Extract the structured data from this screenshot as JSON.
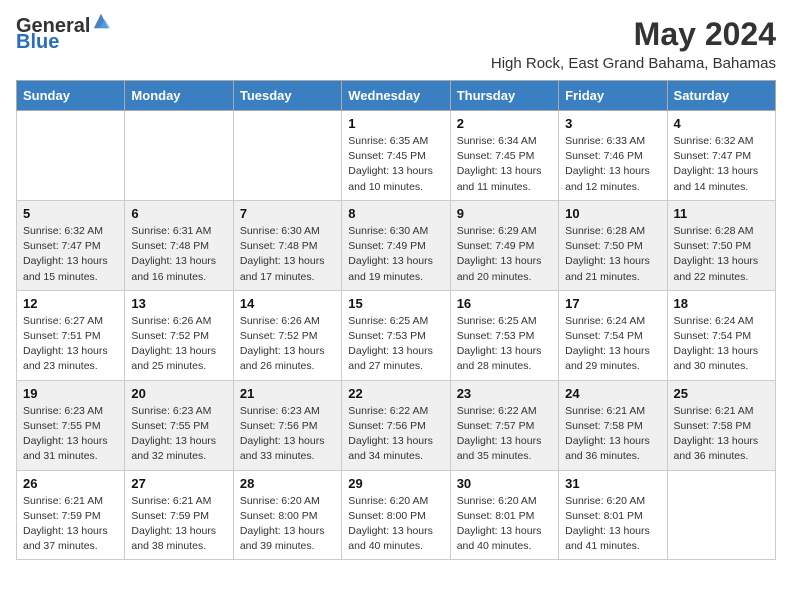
{
  "header": {
    "logo_general": "General",
    "logo_blue": "Blue",
    "title": "May 2024",
    "location": "High Rock, East Grand Bahama, Bahamas"
  },
  "weekdays": [
    "Sunday",
    "Monday",
    "Tuesday",
    "Wednesday",
    "Thursday",
    "Friday",
    "Saturday"
  ],
  "weeks": [
    [
      {
        "day": "",
        "info": ""
      },
      {
        "day": "",
        "info": ""
      },
      {
        "day": "",
        "info": ""
      },
      {
        "day": "1",
        "info": "Sunrise: 6:35 AM\nSunset: 7:45 PM\nDaylight: 13 hours\nand 10 minutes."
      },
      {
        "day": "2",
        "info": "Sunrise: 6:34 AM\nSunset: 7:45 PM\nDaylight: 13 hours\nand 11 minutes."
      },
      {
        "day": "3",
        "info": "Sunrise: 6:33 AM\nSunset: 7:46 PM\nDaylight: 13 hours\nand 12 minutes."
      },
      {
        "day": "4",
        "info": "Sunrise: 6:32 AM\nSunset: 7:47 PM\nDaylight: 13 hours\nand 14 minutes."
      }
    ],
    [
      {
        "day": "5",
        "info": "Sunrise: 6:32 AM\nSunset: 7:47 PM\nDaylight: 13 hours\nand 15 minutes."
      },
      {
        "day": "6",
        "info": "Sunrise: 6:31 AM\nSunset: 7:48 PM\nDaylight: 13 hours\nand 16 minutes."
      },
      {
        "day": "7",
        "info": "Sunrise: 6:30 AM\nSunset: 7:48 PM\nDaylight: 13 hours\nand 17 minutes."
      },
      {
        "day": "8",
        "info": "Sunrise: 6:30 AM\nSunset: 7:49 PM\nDaylight: 13 hours\nand 19 minutes."
      },
      {
        "day": "9",
        "info": "Sunrise: 6:29 AM\nSunset: 7:49 PM\nDaylight: 13 hours\nand 20 minutes."
      },
      {
        "day": "10",
        "info": "Sunrise: 6:28 AM\nSunset: 7:50 PM\nDaylight: 13 hours\nand 21 minutes."
      },
      {
        "day": "11",
        "info": "Sunrise: 6:28 AM\nSunset: 7:50 PM\nDaylight: 13 hours\nand 22 minutes."
      }
    ],
    [
      {
        "day": "12",
        "info": "Sunrise: 6:27 AM\nSunset: 7:51 PM\nDaylight: 13 hours\nand 23 minutes."
      },
      {
        "day": "13",
        "info": "Sunrise: 6:26 AM\nSunset: 7:52 PM\nDaylight: 13 hours\nand 25 minutes."
      },
      {
        "day": "14",
        "info": "Sunrise: 6:26 AM\nSunset: 7:52 PM\nDaylight: 13 hours\nand 26 minutes."
      },
      {
        "day": "15",
        "info": "Sunrise: 6:25 AM\nSunset: 7:53 PM\nDaylight: 13 hours\nand 27 minutes."
      },
      {
        "day": "16",
        "info": "Sunrise: 6:25 AM\nSunset: 7:53 PM\nDaylight: 13 hours\nand 28 minutes."
      },
      {
        "day": "17",
        "info": "Sunrise: 6:24 AM\nSunset: 7:54 PM\nDaylight: 13 hours\nand 29 minutes."
      },
      {
        "day": "18",
        "info": "Sunrise: 6:24 AM\nSunset: 7:54 PM\nDaylight: 13 hours\nand 30 minutes."
      }
    ],
    [
      {
        "day": "19",
        "info": "Sunrise: 6:23 AM\nSunset: 7:55 PM\nDaylight: 13 hours\nand 31 minutes."
      },
      {
        "day": "20",
        "info": "Sunrise: 6:23 AM\nSunset: 7:55 PM\nDaylight: 13 hours\nand 32 minutes."
      },
      {
        "day": "21",
        "info": "Sunrise: 6:23 AM\nSunset: 7:56 PM\nDaylight: 13 hours\nand 33 minutes."
      },
      {
        "day": "22",
        "info": "Sunrise: 6:22 AM\nSunset: 7:56 PM\nDaylight: 13 hours\nand 34 minutes."
      },
      {
        "day": "23",
        "info": "Sunrise: 6:22 AM\nSunset: 7:57 PM\nDaylight: 13 hours\nand 35 minutes."
      },
      {
        "day": "24",
        "info": "Sunrise: 6:21 AM\nSunset: 7:58 PM\nDaylight: 13 hours\nand 36 minutes."
      },
      {
        "day": "25",
        "info": "Sunrise: 6:21 AM\nSunset: 7:58 PM\nDaylight: 13 hours\nand 36 minutes."
      }
    ],
    [
      {
        "day": "26",
        "info": "Sunrise: 6:21 AM\nSunset: 7:59 PM\nDaylight: 13 hours\nand 37 minutes."
      },
      {
        "day": "27",
        "info": "Sunrise: 6:21 AM\nSunset: 7:59 PM\nDaylight: 13 hours\nand 38 minutes."
      },
      {
        "day": "28",
        "info": "Sunrise: 6:20 AM\nSunset: 8:00 PM\nDaylight: 13 hours\nand 39 minutes."
      },
      {
        "day": "29",
        "info": "Sunrise: 6:20 AM\nSunset: 8:00 PM\nDaylight: 13 hours\nand 40 minutes."
      },
      {
        "day": "30",
        "info": "Sunrise: 6:20 AM\nSunset: 8:01 PM\nDaylight: 13 hours\nand 40 minutes."
      },
      {
        "day": "31",
        "info": "Sunrise: 6:20 AM\nSunset: 8:01 PM\nDaylight: 13 hours\nand 41 minutes."
      },
      {
        "day": "",
        "info": ""
      }
    ]
  ]
}
